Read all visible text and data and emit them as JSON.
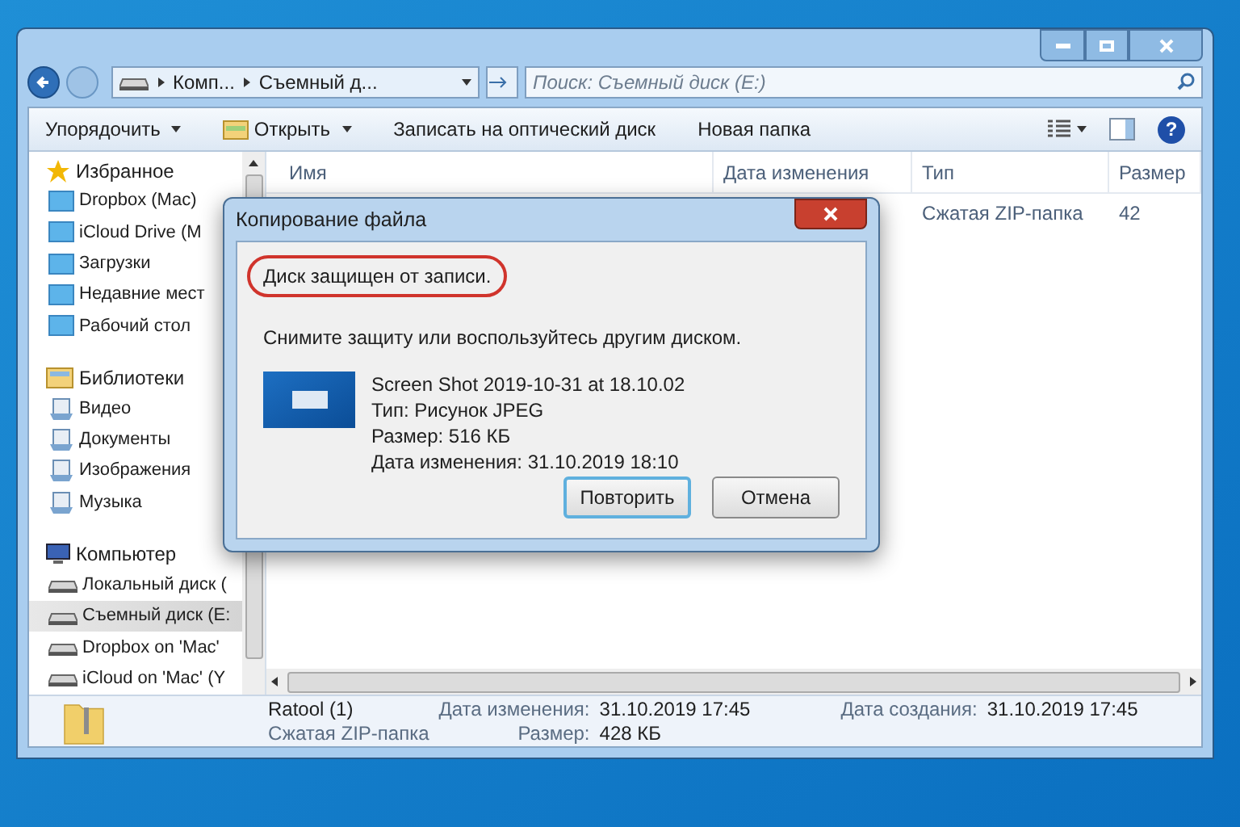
{
  "address_bar": {
    "path": [
      "Комп...",
      "Съемный д..."
    ]
  },
  "search": {
    "placeholder": "Поиск: Съемный диск (E:)"
  },
  "help_button": {
    "label": "?"
  },
  "toolbar": [
    {
      "label": "Упорядочить",
      "kind": "menu"
    },
    {
      "label": "Открыть",
      "kind": "open"
    },
    {
      "label": "Записать на оптический диск",
      "kind": "plain"
    },
    {
      "label": "Новая папка",
      "kind": "plain"
    }
  ],
  "sidebar": {
    "sections": [
      {
        "label": "Избранное",
        "children": [
          {
            "label": "Dropbox (Mac)",
            "selected": false
          },
          {
            "label": "iCloud Drive (M",
            "selected": false
          },
          {
            "label": "Загрузки",
            "selected": false
          },
          {
            "label": "Недавние мест",
            "selected": false
          },
          {
            "label": "Рабочий стол",
            "selected": false
          }
        ]
      },
      {
        "label": "Библиотеки",
        "children": [
          {
            "label": "Видео",
            "selected": false
          },
          {
            "label": "Документы",
            "selected": false
          },
          {
            "label": "Изображения",
            "selected": false
          },
          {
            "label": "Музыка",
            "selected": false
          }
        ]
      },
      {
        "label": "Компьютер",
        "children": [
          {
            "label": "Локальный диск (",
            "selected": false
          },
          {
            "label": "Съемный диск (E:",
            "selected": true
          },
          {
            "label": "Dropbox on 'Mac'",
            "selected": false
          },
          {
            "label": "iCloud on 'Mac' (Y",
            "selected": false
          }
        ]
      }
    ]
  },
  "table": {
    "columns": [
      "Имя",
      "Дата изменения",
      "Тип",
      "Размер"
    ],
    "rows": [
      {
        "type": "Сжатая ZIP-папка",
        "size": "42"
      }
    ]
  },
  "details": {
    "name": "Ratool (1)",
    "file_type": "Сжатая ZIP-папка",
    "fields": [
      {
        "label": "Дата изменения:",
        "value": "31.10.2019 17:45"
      },
      {
        "label": "Дата создания:",
        "value": "31.10.2019 17:45"
      },
      {
        "label": "Размер:",
        "value": "428 КБ"
      }
    ]
  },
  "dialog": {
    "title": "Копирование файла",
    "error": "Диск защищен от записи.",
    "error_circled": true,
    "message": "Снимите защиту или воспользуйтесь другим диском.",
    "file": {
      "name": "Screen Shot 2019-10-31 at 18.10.02",
      "lines": [
        "Тип: Рисунок JPEG",
        "Размер: 516 КБ",
        "Дата изменения: 31.10.2019 18:10"
      ]
    },
    "buttons": [
      {
        "label": "Повторить",
        "selected": true
      },
      {
        "label": "Отмена",
        "selected": false
      }
    ]
  }
}
